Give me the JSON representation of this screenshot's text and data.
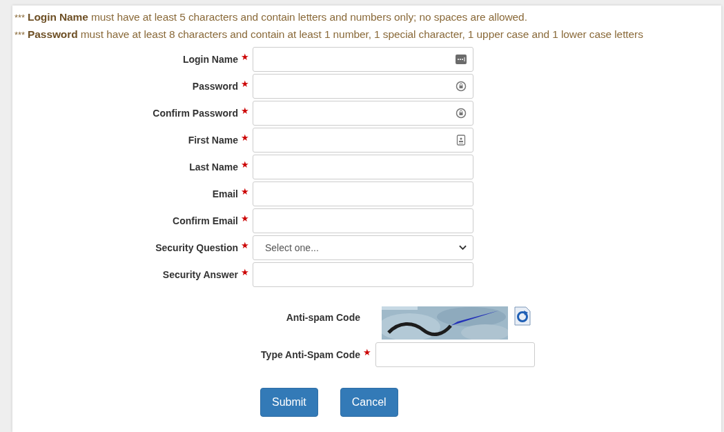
{
  "notes": [
    {
      "prefix": "***",
      "text": "**Login Name** must have at least 5 characters and contain letters and numbers only; no spaces are allowed."
    },
    {
      "prefix": "***",
      "text": "**Password** must have at least 8 characters and contain at least 1 number, 1 special character, 1 upper case and 1 lower case letters"
    }
  ],
  "required_mark": "★",
  "fields": [
    {
      "label": "Login Name",
      "kind": "text",
      "adornment": {
        "kind": "ellipsis-box"
      }
    },
    {
      "label": "Password",
      "kind": "text",
      "adornment": {
        "kind": "lock-circle"
      }
    },
    {
      "label": "Confirm Password",
      "kind": "text",
      "adornment": {
        "kind": "lock-circle"
      }
    },
    {
      "label": "First Name",
      "kind": "text",
      "adornment": {
        "kind": "contact-card"
      }
    },
    {
      "label": "Last Name",
      "kind": "text"
    },
    {
      "label": "Email",
      "kind": "text"
    },
    {
      "label": "Confirm Email",
      "kind": "text"
    },
    {
      "label": "Security Question",
      "kind": "select",
      "value": "Select one..."
    },
    {
      "label": "Security Answer",
      "kind": "text"
    }
  ],
  "anti_spam": {
    "label": "Anti-spam Code",
    "input_label": "Type Anti-Spam Code"
  },
  "buttons": [
    "Submit",
    "Cancel"
  ]
}
